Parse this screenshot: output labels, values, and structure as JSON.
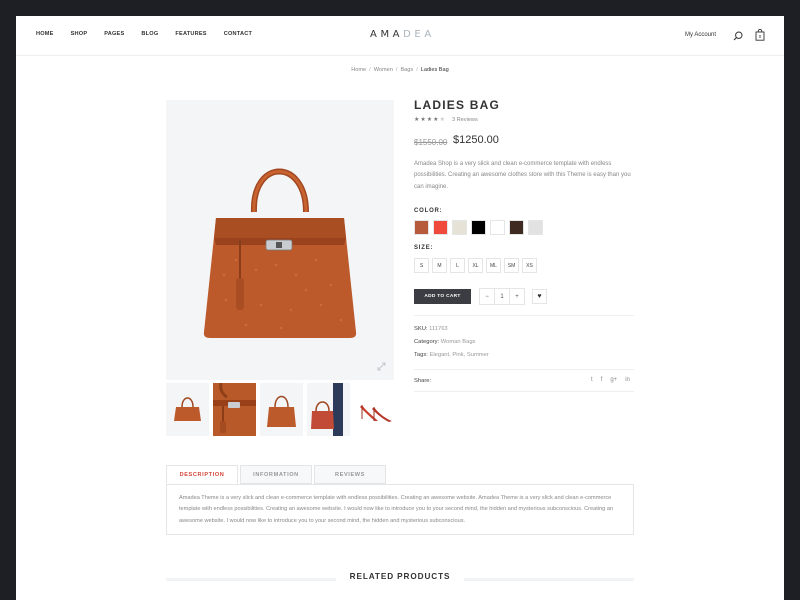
{
  "nav": {
    "items": [
      "HOME",
      "SHOP",
      "PAGES",
      "BLOG",
      "FEATURES",
      "CONTACT"
    ]
  },
  "brand": {
    "logo_dark": "AMA",
    "logo_light": "DEA"
  },
  "header": {
    "account_label": "My Account"
  },
  "breadcrumb": [
    "Home",
    "Women",
    "Bags",
    "Ladies Bag"
  ],
  "product": {
    "title": "LADIES BAG",
    "rating": 4,
    "reviews": "3 Reviews",
    "price_old": "$1550.00",
    "price_new": "$1250.00",
    "description": "Amadea Shop is a very slick and clean e-commerce template with endless possibilities. Creating an awesome clothes store with this Theme is easy than you can imagine.",
    "color_label": "COLOR:",
    "colors": [
      "#b65a3b",
      "#ef4a3c",
      "#e7e2d6",
      "#000000",
      "#ffffff",
      "#3f2a22",
      "#e2e2e2"
    ],
    "size_label": "SIZE:",
    "sizes": [
      "S",
      "M",
      "L",
      "XL",
      "ML",
      "SM",
      "XS"
    ],
    "add_to_cart": "ADD TO CART",
    "quantity": "1",
    "qty_minus": "−",
    "qty_plus": "+",
    "sku_label": "SKU:",
    "sku": "111763",
    "category_label": "Category:",
    "category": "Woman Bags",
    "tags_label": "Tags:",
    "tags": "Elegant, Pink, Summer",
    "share_label": "Share:"
  },
  "tabs": {
    "items": [
      "DESCRIPTION",
      "INFORMATION",
      "REVIEWS"
    ],
    "active": 0,
    "content": "Amadea Theme is a very slick and clean e-commerce template with endless possibilities. Creating an awesome website. Amadea Theme is a very slick and clean e-commerce template with endless possibilities. Creating an awesome website. I would now like to introduce you to your second mind, the hidden and mysterious subconscious. Creating an awesome website. I would now like to introduce you to your second mind, the hidden and mysterious subconscious."
  },
  "related": {
    "title": "RELATED PRODUCTS"
  },
  "icons": {
    "search": "search-icon",
    "cart": "shopping-bag-icon",
    "zoom": "expand-icon",
    "wishlist": "heart-icon",
    "social": [
      "twitter-icon",
      "facebook-icon",
      "google-plus-icon",
      "linkedin-icon"
    ]
  },
  "accent_color": "#d4473b"
}
